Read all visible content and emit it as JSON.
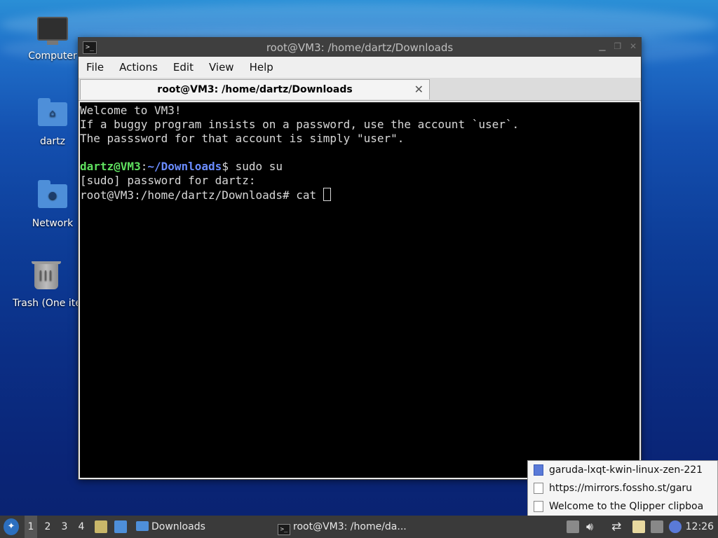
{
  "desktop": {
    "icons": [
      {
        "label": "Computer"
      },
      {
        "label": "dartz"
      },
      {
        "label": "Network"
      },
      {
        "label": "Trash (One ite"
      }
    ]
  },
  "window": {
    "title": "root@VM3: /home/dartz/Downloads",
    "menu": [
      "File",
      "Actions",
      "Edit",
      "View",
      "Help"
    ],
    "tab_title": "root@VM3: /home/dartz/Downloads",
    "terminal": {
      "line1": "Welcome to VM3!",
      "line2": "If a buggy program insists on a password, use the account `user`.",
      "line3": "The passsword for that account is simply \"user\".",
      "prompt_user": "dartz@VM3",
      "prompt_colon": ":",
      "prompt_path": "~/Downloads",
      "prompt_dollar": "$ sudo su",
      "sudo_line": "[sudo] password for dartz:",
      "root_line": "root@VM3:/home/dartz/Downloads# cat "
    }
  },
  "clipboard": {
    "items": [
      "garuda-lxqt-kwin-linux-zen-221",
      "https://mirrors.fossho.st/garu",
      "Welcome to the Qlipper clipboa"
    ]
  },
  "taskbar": {
    "desktops": [
      "1",
      "2",
      "3",
      "4"
    ],
    "folder_task": "Downloads",
    "terminal_task": "root@VM3: /home/da...",
    "clock": "12:26"
  },
  "colors": {
    "accent": "#2c6fbf",
    "prompt_green": "#5fe05f",
    "prompt_blue": "#6a8cff"
  }
}
